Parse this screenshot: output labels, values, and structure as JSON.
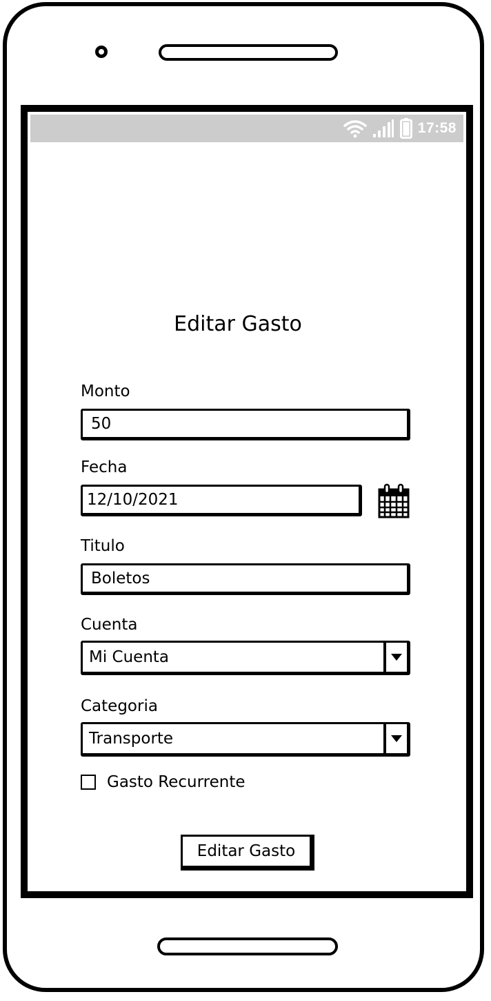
{
  "status_bar": {
    "time": "17:58",
    "icons": [
      "wifi-icon",
      "signal-icon",
      "battery-icon"
    ]
  },
  "form": {
    "title": "Editar Gasto",
    "monto": {
      "label": "Monto",
      "value": "50"
    },
    "fecha": {
      "label": "Fecha",
      "value": "12/10/2021",
      "picker_icon": "calendar-icon"
    },
    "titulo": {
      "label": "Titulo",
      "value": "Boletos"
    },
    "cuenta": {
      "label": "Cuenta",
      "value": "Mi Cuenta"
    },
    "categoria": {
      "label": "Categoria",
      "value": "Transporte"
    },
    "recurrente": {
      "label": "Gasto Recurrente",
      "checked": false
    },
    "submit_label": "Editar Gasto"
  },
  "colors": {
    "status_bar_bg": "#cccccc",
    "status_fg": "#ffffff",
    "ink": "#000000"
  }
}
